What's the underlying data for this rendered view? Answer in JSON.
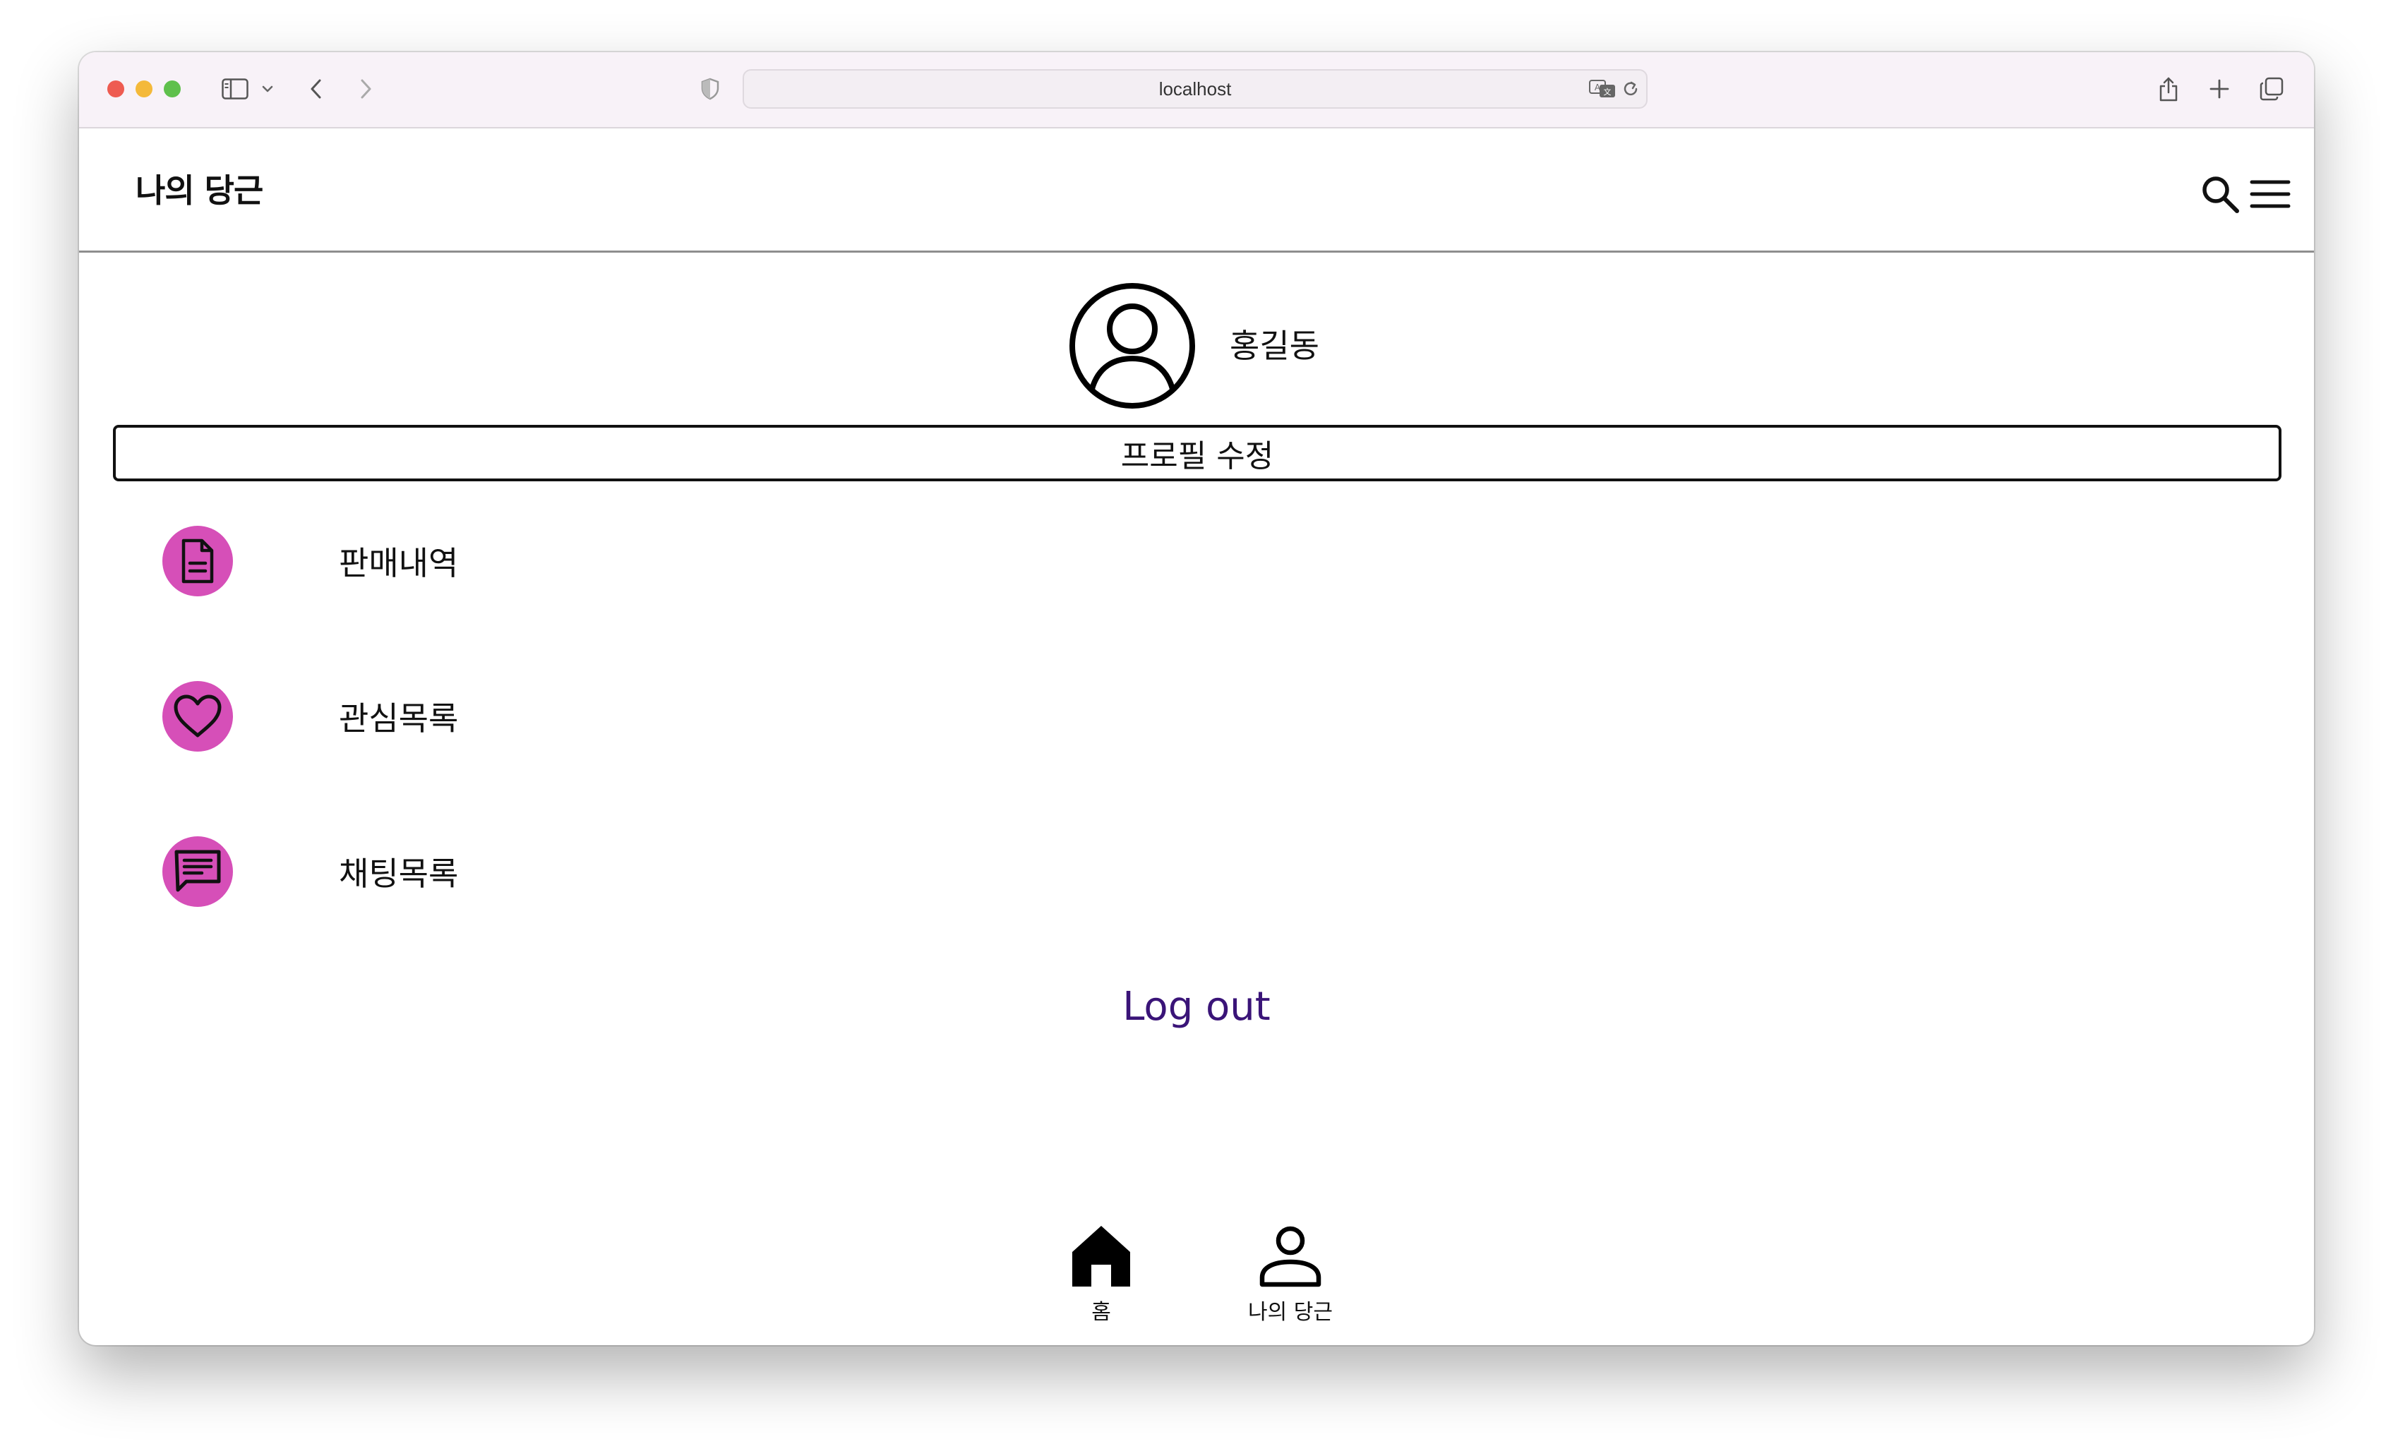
{
  "browser": {
    "url": "localhost"
  },
  "header": {
    "title": "나의 당근",
    "search_icon": "search-icon",
    "menu_icon": "hamburger-menu-icon"
  },
  "profile": {
    "name": "홍길동",
    "avatar_icon": "user-circle-icon",
    "edit_button_label": "프로필 수정"
  },
  "menu": {
    "items": [
      {
        "label": "판매내역",
        "icon": "document-icon"
      },
      {
        "label": "관심목록",
        "icon": "heart-icon"
      },
      {
        "label": "채팅목록",
        "icon": "chat-icon"
      }
    ],
    "icon_bg_color": "#d64fb8"
  },
  "logout_label": "Log out",
  "logout_color": "#3a1478",
  "bottom_nav": {
    "items": [
      {
        "label": "홈",
        "icon": "home-icon"
      },
      {
        "label": "나의 당근",
        "icon": "user-icon"
      }
    ]
  }
}
